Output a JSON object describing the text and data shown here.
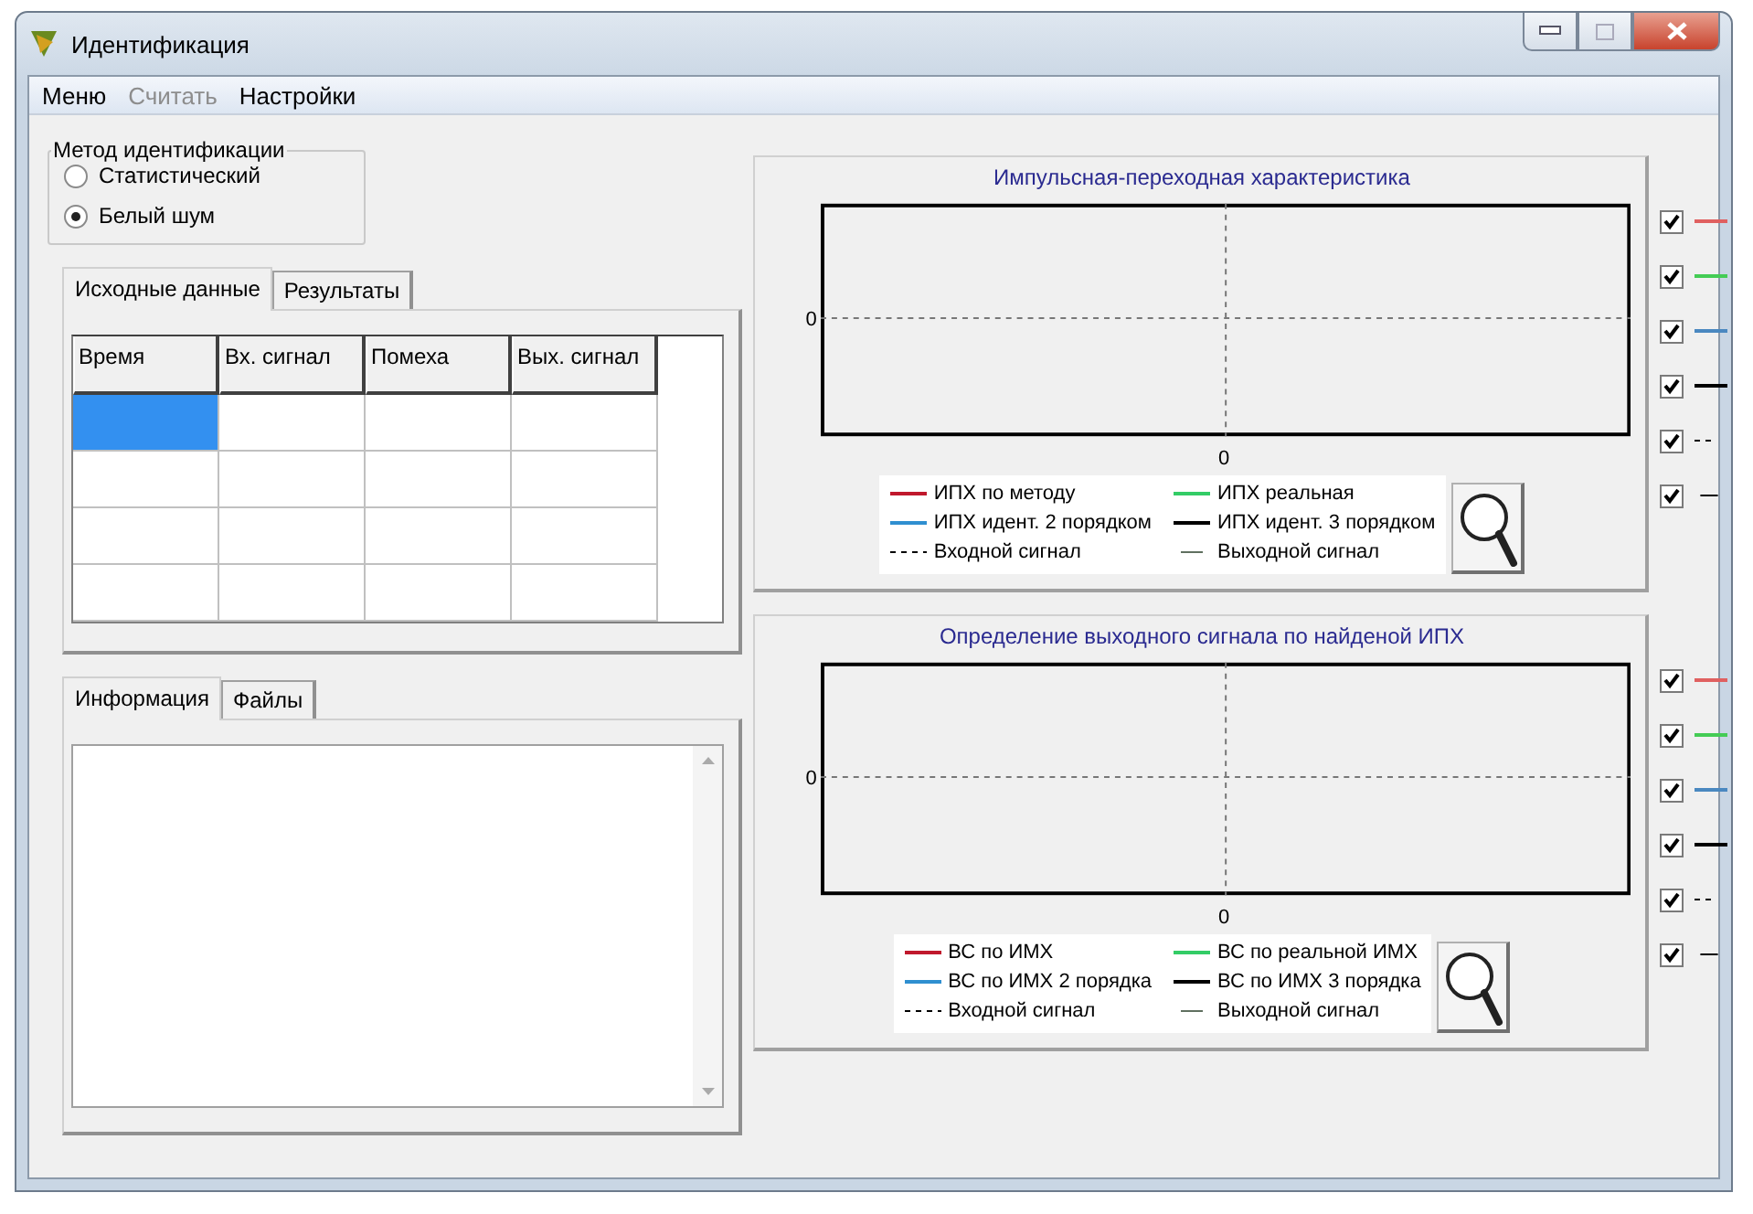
{
  "window": {
    "title": "Идентификация"
  },
  "menu": [
    {
      "label": "Меню",
      "disabled": false
    },
    {
      "label": "Считать",
      "disabled": true
    },
    {
      "label": "Настройки",
      "disabled": false
    }
  ],
  "method_group": {
    "title": "Метод идентификации",
    "options": [
      {
        "label": "Статистический",
        "selected": false
      },
      {
        "label": "Белый шум",
        "selected": true
      }
    ]
  },
  "data_tabs": [
    {
      "label": "Исходные данные",
      "selected": true
    },
    {
      "label": "Результаты",
      "selected": false
    }
  ],
  "table": {
    "columns": [
      "Время",
      "Вх. сигнал",
      "Помеха",
      "Вых. сигнал"
    ],
    "rows": [
      {
        "cells_selected": [
          true,
          false,
          false,
          false
        ]
      },
      {
        "cells_selected": [
          false,
          false,
          false,
          false
        ]
      },
      {
        "cells_selected": [
          false,
          false,
          false,
          false
        ]
      },
      {
        "cells_selected": [
          false,
          false,
          false,
          false
        ]
      }
    ]
  },
  "info_tabs": [
    {
      "label": "Информация",
      "selected": true
    },
    {
      "label": "Файлы",
      "selected": false
    }
  ],
  "charts": [
    {
      "title": "Импульсная-переходная характеристика",
      "y_tick": "0",
      "x_tick": "0",
      "legend": [
        {
          "label": "ИПХ по методу",
          "color": "#c0182c",
          "kind": "solid"
        },
        {
          "label": "ИПХ реальная",
          "color": "#33cc66",
          "kind": "solid"
        },
        {
          "label": "ИПХ идент. 2 порядком",
          "color": "#2f8fd0",
          "kind": "solid"
        },
        {
          "label": "ИПХ идент. 3 порядком",
          "color": "#000000",
          "kind": "solid"
        },
        {
          "label": "Входной сигнал",
          "color": "#000000",
          "kind": "dashed"
        },
        {
          "label": "Выходной сигнал",
          "color": "#607060",
          "kind": "short"
        }
      ],
      "toggles": [
        {
          "checked": true,
          "color": "#e06060",
          "kind": "solid"
        },
        {
          "checked": true,
          "color": "#44cc55",
          "kind": "solid"
        },
        {
          "checked": true,
          "color": "#4a88c0",
          "kind": "solid"
        },
        {
          "checked": true,
          "color": "#000000",
          "kind": "solid"
        },
        {
          "checked": true,
          "color": "#000000",
          "kind": "dashed"
        },
        {
          "checked": true,
          "color": "#000000",
          "kind": "short"
        }
      ]
    },
    {
      "title": "Определение выходного сигнала по найденой ИПХ",
      "y_tick": "0",
      "x_tick": "0",
      "legend": [
        {
          "label": "ВС по ИМХ",
          "color": "#c0182c",
          "kind": "solid"
        },
        {
          "label": "ВС по реальной ИМХ",
          "color": "#33cc66",
          "kind": "solid"
        },
        {
          "label": "ВС по ИМХ 2 порядка",
          "color": "#2f8fd0",
          "kind": "solid"
        },
        {
          "label": "ВС по ИМХ 3 порядка",
          "color": "#000000",
          "kind": "solid"
        },
        {
          "label": "Входной сигнал",
          "color": "#000000",
          "kind": "dashed"
        },
        {
          "label": "Выходной сигнал",
          "color": "#607060",
          "kind": "short"
        }
      ],
      "toggles": [
        {
          "checked": true,
          "color": "#e06060",
          "kind": "solid"
        },
        {
          "checked": true,
          "color": "#44cc55",
          "kind": "solid"
        },
        {
          "checked": true,
          "color": "#4a88c0",
          "kind": "solid"
        },
        {
          "checked": true,
          "color": "#000000",
          "kind": "solid"
        },
        {
          "checked": true,
          "color": "#000000",
          "kind": "dashed"
        },
        {
          "checked": true,
          "color": "#000000",
          "kind": "short"
        }
      ]
    }
  ]
}
